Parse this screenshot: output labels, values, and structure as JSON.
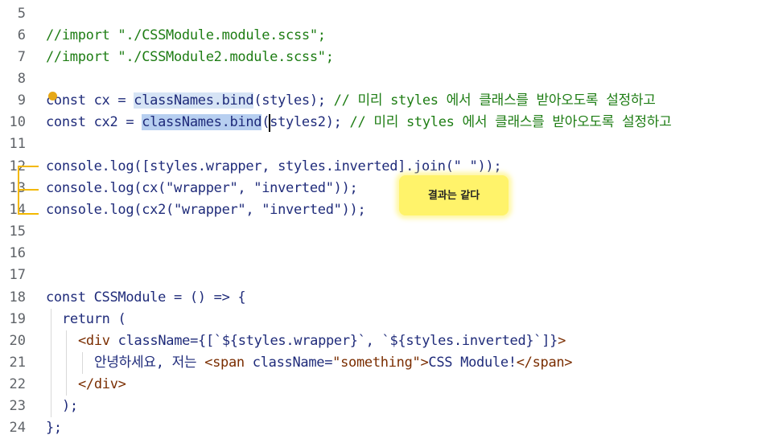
{
  "editor": {
    "line_numbers": [
      "5",
      "6",
      "7",
      "8",
      "9",
      "10",
      "11",
      "12",
      "13",
      "14",
      "15",
      "16",
      "17",
      "18",
      "19",
      "20",
      "21",
      "22",
      "23",
      "24"
    ],
    "lines": {
      "l6": "//import \"./CSSModule.module.scss\";",
      "l7": "//import \"./CSSModule2.module.scss\";",
      "l9_pre": "const cx = ",
      "l9_hl": "classNames.bind",
      "l9_post": "(styles);",
      "l9_comment": " // 미리 styles 에서 클래스를 받아오도록 설정하고",
      "l10_pre": "const cx2 = ",
      "l10_hl": "classNames.bind",
      "l10_post": "(styles2);",
      "l10_comment": " // 미리 styles 에서 클래스를 받아오도록 설정하고",
      "l12": "console.log([styles.wrapper, styles.inverted].join(\" \"));",
      "l13": "console.log(cx(\"wrapper\", \"inverted\"));",
      "l14": "console.log(cx2(\"wrapper\", \"inverted\"));",
      "l18": "const CSSModule = () => {",
      "l19": "return (",
      "l20_open": "<div",
      "l20_attr": " className",
      "l20_rest": "={[`${styles.wrapper}`, `${styles.inverted}`]}",
      "l20_close": ">",
      "l21_text": "안녕하세요, 저는 ",
      "l21_span_open": "<span",
      "l21_attr": " className",
      "l21_eq": "=",
      "l21_val": "\"something\"",
      "l21_close": ">",
      "l21_inner": "CSS Module!",
      "l21_end": "</span>",
      "l22": "</div>",
      "l23": ");",
      "l24": "};"
    }
  },
  "annotation": {
    "text": "결과는 같다",
    "color": "#fff36a",
    "bracket_color": "#f3b800"
  }
}
